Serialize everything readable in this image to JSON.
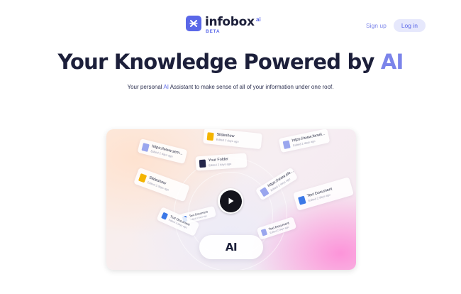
{
  "header": {
    "logo_word": "infobox",
    "logo_sup": "ai",
    "logo_badge": "BETA",
    "signup_label": "Sign up",
    "login_label": "Log in"
  },
  "hero": {
    "title_main": "Your Knowledge Powered by ",
    "title_accent": "AI",
    "subtitle_before": "Your personal ",
    "subtitle_accent": "AI",
    "subtitle_after": " Assistant to make sense of all of your information under one roof."
  },
  "video": {
    "ai_label": "AI",
    "cards": [
      {
        "title": "Slideshow",
        "meta": "Edited 2 days ago"
      },
      {
        "title": "https://www.sem...",
        "meta": "Edited 2 days ago"
      },
      {
        "title": "https://www.forsel...",
        "meta": "Edited 2 days ago"
      },
      {
        "title": "Your Folder",
        "meta": "Edited 2 days ago"
      },
      {
        "title": "Slideshow",
        "meta": "Edited 2 days ago"
      },
      {
        "title": "https://www.ele...",
        "meta": "Edited 2 days ago"
      },
      {
        "title": "Text Document",
        "meta": "Edited 2 days ago"
      },
      {
        "title": "Text Document",
        "meta": "Edited 2 days ago"
      },
      {
        "title": "Text Document",
        "meta": "Edited 2 days ago"
      },
      {
        "title": "Text Document",
        "meta": "Edited 2 days ago"
      }
    ]
  },
  "colors": {
    "accent": "#5a67e8",
    "accent_light": "#7b84ea",
    "text_dark": "#1c1f3a"
  },
  "icons": [
    "logo-x-icon",
    "play-icon",
    "document-icon",
    "folder-icon",
    "link-icon"
  ]
}
